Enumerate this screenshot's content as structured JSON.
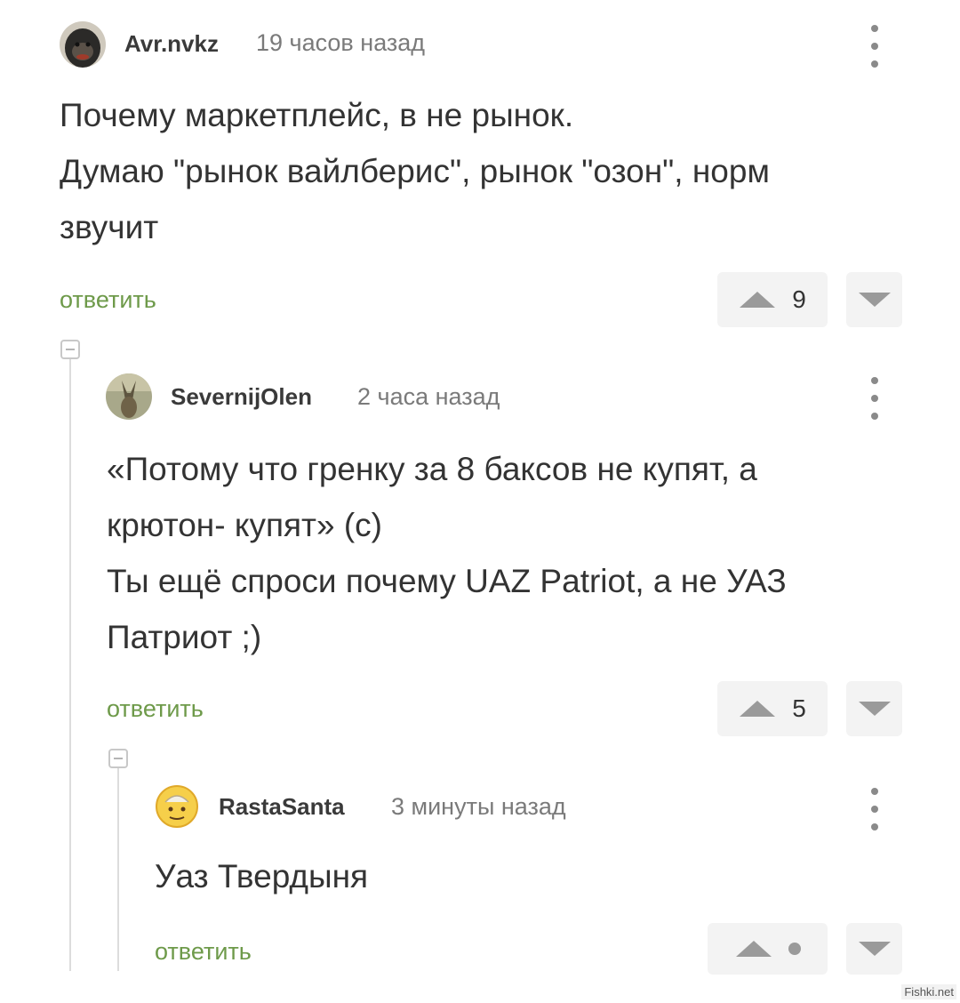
{
  "comments": [
    {
      "username": "Avr.nvkz",
      "timestamp": "19 часов назад",
      "text": "Почему маркетплейс, в не рынок.\nДумаю \"рынок вайлберис\", рынок \"озон\", норм\nзвучит",
      "reply_label": "ответить",
      "rating": "9",
      "avatar_icon": "gorilla-avatar-icon"
    },
    {
      "username": "SevernijOlen",
      "timestamp": "2 часа назад",
      "text": "«Потому что гренку за 8 баксов не купят, а\nкрютон- купят» (с)\nТы ещё спроси почему UAZ Patriot, а не УАЗ\nПатриот ;)",
      "reply_label": "ответить",
      "rating": "5",
      "avatar_icon": "deer-avatar-icon"
    },
    {
      "username": "RastaSanta",
      "timestamp": "3 минуты назад",
      "text": "Уаз Твердыня",
      "reply_label": "ответить",
      "rating": "",
      "avatar_icon": "smiley-avatar-icon"
    }
  ],
  "colors": {
    "reply_link": "#6e9a4a",
    "vote_box": "#f3f3f3",
    "vote_arrow": "#9a9a9a",
    "thread_line": "#dcdcdc"
  },
  "watermark": "Fishki.net"
}
